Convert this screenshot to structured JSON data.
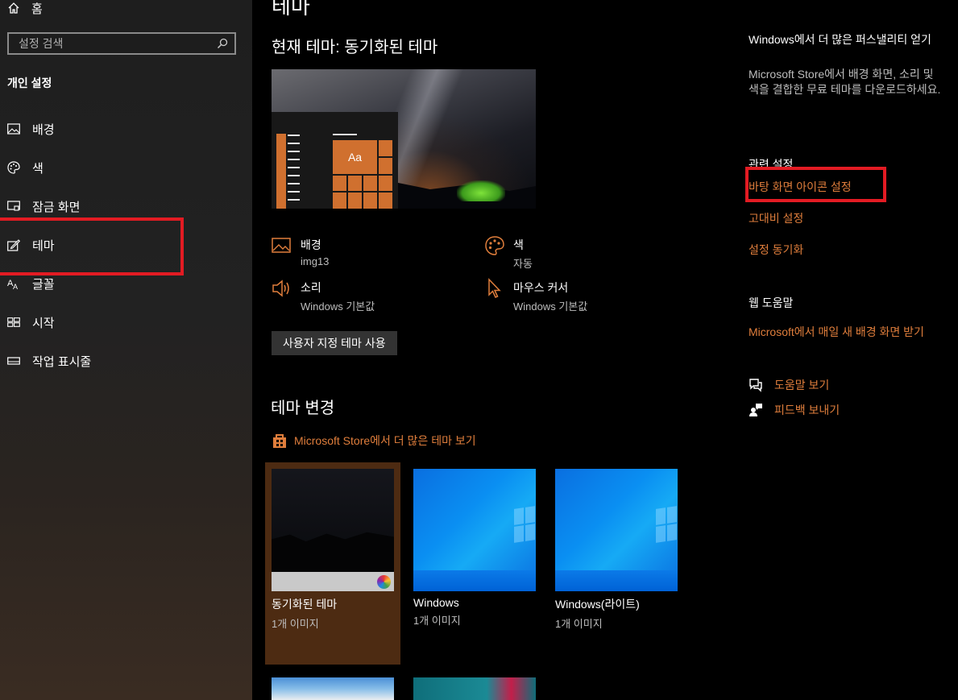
{
  "sidebar": {
    "home_label": "홈",
    "search_placeholder": "설정 검색",
    "section_title": "개인 설정",
    "items": [
      {
        "label": "배경",
        "icon": "picture-icon"
      },
      {
        "label": "색",
        "icon": "palette-icon"
      },
      {
        "label": "잠금 화면",
        "icon": "lock-screen-icon"
      },
      {
        "label": "테마",
        "icon": "theme-brush-icon"
      },
      {
        "label": "글꼴",
        "icon": "font-icon"
      },
      {
        "label": "시작",
        "icon": "start-icon"
      },
      {
        "label": "작업 표시줄",
        "icon": "taskbar-icon"
      }
    ]
  },
  "main": {
    "page_title": "테마",
    "current_theme": "현재 테마: 동기화된 테마",
    "preview_tile_label": "Aa",
    "properties": [
      {
        "name": "배경",
        "value": "img13",
        "icon": "picture-icon"
      },
      {
        "name": "색",
        "value": "자동",
        "icon": "palette-icon"
      },
      {
        "name": "소리",
        "value": "Windows 기본값",
        "icon": "speaker-icon"
      },
      {
        "name": "마우스 커서",
        "value": "Windows 기본값",
        "icon": "cursor-icon"
      }
    ],
    "custom_theme_button": "사용자 지정 테마 사용",
    "change_title": "테마 변경",
    "store_link": "Microsoft Store에서 더 많은 테마 보기",
    "themes": [
      {
        "name": "동기화된 테마",
        "count": "1개 이미지",
        "selected": true
      },
      {
        "name": "Windows",
        "count": "1개 이미지",
        "selected": false
      },
      {
        "name": "Windows(라이트)",
        "count": "1개 이미지",
        "selected": false
      }
    ]
  },
  "right": {
    "store_heading": "Windows에서 더 많은 퍼스낼리티 얻기",
    "store_desc": "Microsoft Store에서 배경 화면, 소리 및 색을 결합한 무료 테마를 다운로드하세요.",
    "related_title": "관련 설정",
    "related_links": [
      "바탕 화면 아이콘 설정",
      "고대비 설정",
      "설정 동기화"
    ],
    "web_help_title": "웹 도움말",
    "web_help_link": "Microsoft에서 매일 새 배경 화면 받기",
    "help_link": "도움말 보기",
    "feedback_link": "피드백 보내기"
  },
  "colors": {
    "accent": "#e07e3c",
    "highlight_box": "#e31b23",
    "selected_tile_bg": "#4d2b12"
  }
}
